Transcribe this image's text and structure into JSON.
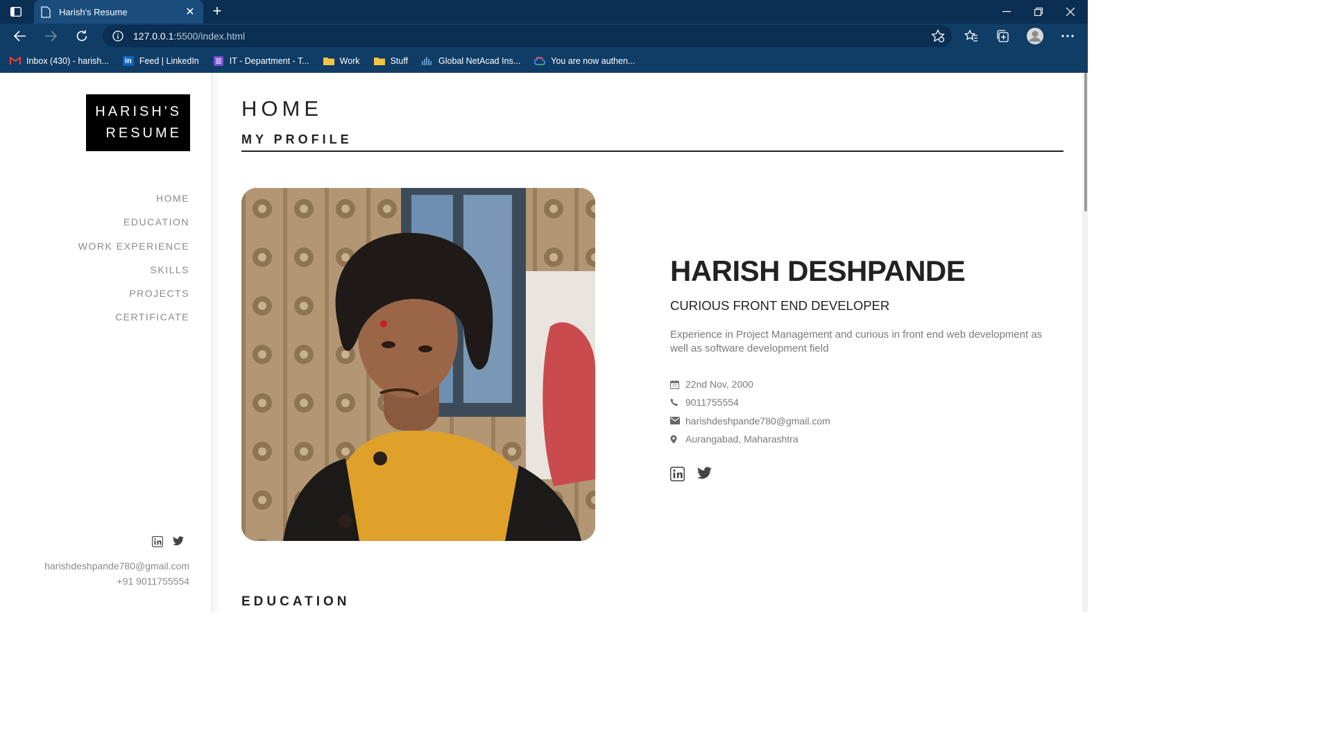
{
  "browser": {
    "tab_title": "Harish's Resume",
    "url_host": "127.0.0.1",
    "url_rest": ":5500/index.html",
    "bookmarks": [
      {
        "label": "Inbox (430) - harish...",
        "icon": "gmail-icon"
      },
      {
        "label": "Feed | LinkedIn",
        "icon": "linkedin-icon"
      },
      {
        "label": "IT - Department - T...",
        "icon": "list-icon"
      },
      {
        "label": "Work",
        "icon": "folder-icon"
      },
      {
        "label": "Stuff",
        "icon": "folder-icon"
      },
      {
        "label": "Global NetAcad Ins...",
        "icon": "netacad-icon"
      },
      {
        "label": "You are now authen...",
        "icon": "google-cloud-icon"
      }
    ]
  },
  "sidebar": {
    "logo_line1": "HARISH'S",
    "logo_line2": "RESUME",
    "menu": [
      "HOME",
      "EDUCATION",
      "WORK EXPERIENCE",
      "SKILLS",
      "PROJECTS",
      "CERTIFICATE"
    ],
    "email": "harishdeshpande780@gmail.com",
    "phone": "+91 9011755554"
  },
  "main": {
    "heading": "HOME",
    "subheading": "MY PROFILE",
    "name": "HARISH DESHPANDE",
    "role": "CURIOUS FRONT END DEVELOPER",
    "bio": "Experience in Project Management and curious in front end web development as well as software development field",
    "info": {
      "dob": "22nd Nov, 2000",
      "phone": "9011755554",
      "email": "harishdeshpande780@gmail.com",
      "location": "Aurangabad, Maharashtra"
    },
    "next_section": "EDUCATION"
  },
  "colors": {
    "chrome": "#0f3d66",
    "tabbar": "#0b2f52",
    "menu_text": "#8a8a8a",
    "accent_text": "#222222"
  }
}
